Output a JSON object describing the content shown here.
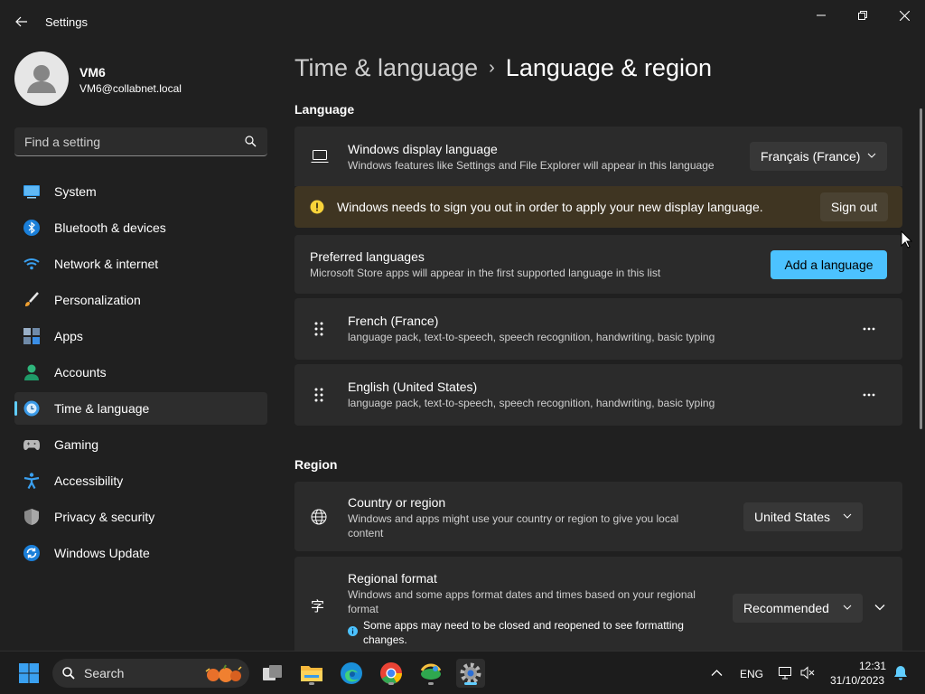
{
  "window": {
    "title": "Settings"
  },
  "profile": {
    "name": "VM6",
    "email": "VM6@collabnet.local"
  },
  "search": {
    "placeholder": "Find a setting"
  },
  "nav": {
    "items": [
      {
        "label": "System",
        "icon": "system-icon"
      },
      {
        "label": "Bluetooth & devices",
        "icon": "bluetooth-icon"
      },
      {
        "label": "Network & internet",
        "icon": "wifi-icon"
      },
      {
        "label": "Personalization",
        "icon": "brush-icon"
      },
      {
        "label": "Apps",
        "icon": "apps-icon"
      },
      {
        "label": "Accounts",
        "icon": "accounts-icon"
      },
      {
        "label": "Time & language",
        "icon": "time-language-icon",
        "active": true
      },
      {
        "label": "Gaming",
        "icon": "gamepad-icon"
      },
      {
        "label": "Accessibility",
        "icon": "accessibility-icon"
      },
      {
        "label": "Privacy & security",
        "icon": "shield-icon"
      },
      {
        "label": "Windows Update",
        "icon": "update-icon"
      }
    ]
  },
  "breadcrumb": {
    "parent": "Time & language",
    "separator": "›",
    "current": "Language & region"
  },
  "language": {
    "heading": "Language",
    "display": {
      "title": "Windows display language",
      "desc": "Windows features like Settings and File Explorer will appear in this language",
      "value": "Français (France)"
    },
    "warning": {
      "text": "Windows needs to sign you out in order to apply your new display language.",
      "button": "Sign out"
    },
    "preferred": {
      "title": "Preferred languages",
      "desc": "Microsoft Store apps will appear in the first supported language in this list",
      "button": "Add a language"
    },
    "list": [
      {
        "name": "French (France)",
        "features": "language pack, text-to-speech, speech recognition, handwriting, basic typing"
      },
      {
        "name": "English (United States)",
        "features": "language pack, text-to-speech, speech recognition, handwriting, basic typing"
      }
    ]
  },
  "region": {
    "heading": "Region",
    "country": {
      "title": "Country or region",
      "desc": "Windows and apps might use your country or region to give you local content",
      "value": "United States"
    },
    "format": {
      "title": "Regional format",
      "desc": "Windows and some apps format dates and times based on your regional format",
      "info": "Some apps may need to be closed and reopened to see formatting changes.",
      "value": "Recommended"
    }
  },
  "taskbar": {
    "search_label": "Search",
    "lang": "ENG",
    "time": "12:31",
    "date": "31/10/2023"
  },
  "colors": {
    "accent": "#60cdff",
    "warning_bg": "#3f3522",
    "warning_icon": "#f8d33a",
    "button_accent": "#4cc2ff"
  }
}
